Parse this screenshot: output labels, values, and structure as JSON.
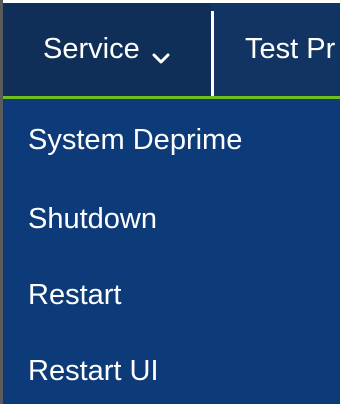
{
  "navbar": {
    "service_label": "Service",
    "service_icon": "chevron-down-icon",
    "test_label": "Test Pr"
  },
  "menu": {
    "items": [
      {
        "label": "System Deprime"
      },
      {
        "label": "Shutdown"
      },
      {
        "label": "Restart"
      },
      {
        "label": "Restart UI"
      }
    ]
  },
  "colors": {
    "nav_bg": "#113463",
    "menu_bg": "#0d3a79",
    "accent": "#6fbe1b",
    "text": "#ffffff"
  }
}
